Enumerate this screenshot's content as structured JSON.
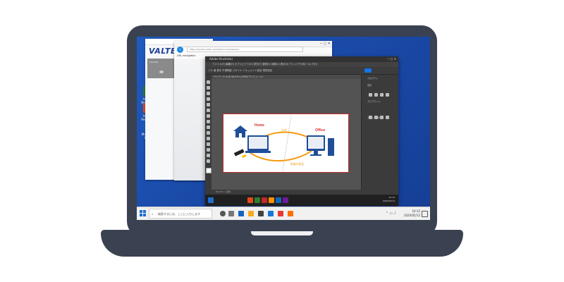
{
  "desktop": {
    "icons": [
      {
        "label": "VALTEC Remote 1"
      },
      {
        "label": "VALTEC Remote 2"
      },
      {
        "label": "Microsoft Edge"
      }
    ]
  },
  "valtec_window": {
    "logo": "VALTEC",
    "dropdown_label": "Connect"
  },
  "browser_window": {
    "tab_title": "URL navigation",
    "address": "https://remote.valtec.example/connect/session"
  },
  "illustrator": {
    "title": "Adobe Illustrator",
    "menu": "ファイル(F)  編集(E)  オブジェクト(O)  書式(T)  選択(S)  効果(C)  表示(V)  ウィンドウ(W)  ヘルプ(H)",
    "doc_tab": "テレワーク.ai @ 66.67% (CMYK/プレビュー) ×",
    "control_bar": "パス   線   基本   不透明度   スタイル   ドキュメント設定   環境設定",
    "panel_sections": [
      "プロパティ",
      "変形",
      "アピアランス",
      "クイック操作"
    ],
    "status": "66.67%   1   選択",
    "artboard": {
      "home_label": "Home",
      "office_label": "Office",
      "line_label_top": "在宅",
      "line_label_bottom": "高速を転送"
    }
  },
  "taskbar": {
    "search_placeholder": "検索するには、ここに入力します",
    "time": "10:15",
    "date": "2020/05/12",
    "inner_time": "10:15",
    "inner_date": "2020/05/12"
  },
  "colors": {
    "desktop_blue": "#1a4aa8",
    "laptop_frame": "#3a4150",
    "artboard_border": "#c62828",
    "orange_path": "#f39c12",
    "home_text": "#d32f2f",
    "office_text": "#d32f2f"
  }
}
